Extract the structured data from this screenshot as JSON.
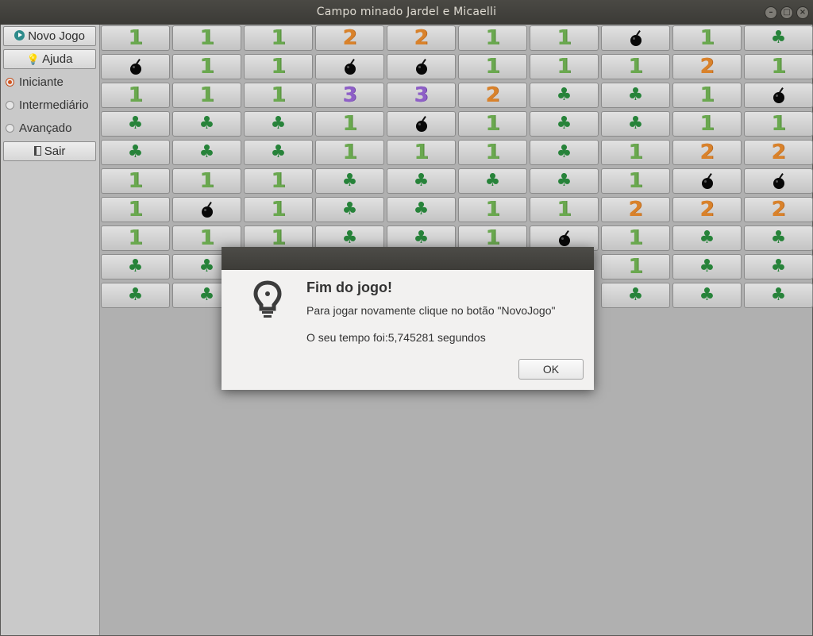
{
  "window": {
    "title": "Campo minado Jardel e Micaelli",
    "controls": [
      "minimize-icon",
      "maximize-icon",
      "close-icon"
    ]
  },
  "sidebar": {
    "new_game": {
      "label": "Novo Jogo",
      "icon": "play-icon"
    },
    "help": {
      "label": "Ajuda",
      "icon": "lightbulb-icon"
    },
    "levels": [
      {
        "label": "Iniciante",
        "selected": true
      },
      {
        "label": "Intermediário",
        "selected": false
      },
      {
        "label": "Avançado",
        "selected": false
      }
    ],
    "exit": {
      "label": "Sair",
      "icon": "exit-icon"
    }
  },
  "board": {
    "legend": {
      "C": "clover-icon",
      "B": "bomb-icon",
      "X": "hidden"
    },
    "rows": [
      [
        "1",
        "1",
        "1",
        "2",
        "2",
        "1",
        "1",
        "B",
        "1",
        "C"
      ],
      [
        "B",
        "1",
        "1",
        "B",
        "B",
        "1",
        "1",
        "1",
        "2",
        "1"
      ],
      [
        "1",
        "1",
        "1",
        "3",
        "3",
        "2",
        "C",
        "C",
        "1",
        "B"
      ],
      [
        "C",
        "C",
        "C",
        "1",
        "B",
        "1",
        "C",
        "C",
        "1",
        "1"
      ],
      [
        "C",
        "C",
        "C",
        "1",
        "1",
        "1",
        "C",
        "1",
        "2",
        "2"
      ],
      [
        "1",
        "1",
        "1",
        "C",
        "C",
        "C",
        "C",
        "1",
        "B",
        "B"
      ],
      [
        "1",
        "B",
        "1",
        "C",
        "C",
        "1",
        "1",
        "2",
        "2",
        "2"
      ],
      [
        "1",
        "1",
        "1",
        "C",
        "C",
        "1",
        "B",
        "1",
        "C",
        "C"
      ],
      [
        "C",
        "C",
        "X",
        "X",
        "X",
        "X",
        "X",
        "1",
        "C",
        "C"
      ],
      [
        "C",
        "C",
        "X",
        "X",
        "X",
        "X",
        "X",
        "C",
        "C",
        "C"
      ]
    ],
    "colors": {
      "1": "#6aa84f",
      "2": "#d9822b",
      "3": "#8e5fc7",
      "clover": "#27833a"
    }
  },
  "dialog": {
    "icon": "lightbulb-icon",
    "title": "Fim do jogo!",
    "message": "Para jogar novamente clique no botão \"NovoJogo\"",
    "time": "O seu tempo foi:5,745281 segundos",
    "ok_label": "OK"
  }
}
